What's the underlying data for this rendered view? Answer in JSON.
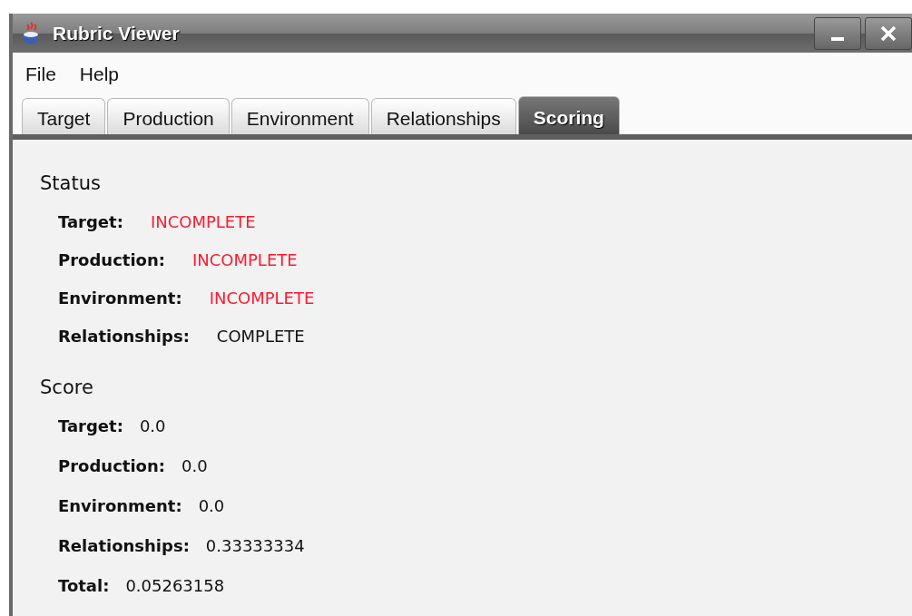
{
  "window": {
    "title": "Rubric Viewer"
  },
  "menu": [
    "File",
    "Help"
  ],
  "tabs": [
    {
      "label": "Target",
      "selected": false
    },
    {
      "label": "Production",
      "selected": false
    },
    {
      "label": "Environment",
      "selected": false
    },
    {
      "label": "Relationships",
      "selected": false
    },
    {
      "label": "Scoring",
      "selected": true
    }
  ],
  "status": {
    "heading": "Status",
    "rows": [
      {
        "label": "Target:",
        "value": "INCOMPLETE",
        "complete": false
      },
      {
        "label": "Production:",
        "value": "INCOMPLETE",
        "complete": false
      },
      {
        "label": "Environment:",
        "value": "INCOMPLETE",
        "complete": false
      },
      {
        "label": "Relationships:",
        "value": "COMPLETE",
        "complete": true
      }
    ]
  },
  "score": {
    "heading": "Score",
    "rows": [
      {
        "label": "Target:",
        "value": "0.0"
      },
      {
        "label": "Production:",
        "value": "0.0"
      },
      {
        "label": "Environment:",
        "value": "0.0"
      },
      {
        "label": "Relationships:",
        "value": "0.33333334"
      },
      {
        "label": "Total:",
        "value": "0.05263158"
      }
    ]
  }
}
